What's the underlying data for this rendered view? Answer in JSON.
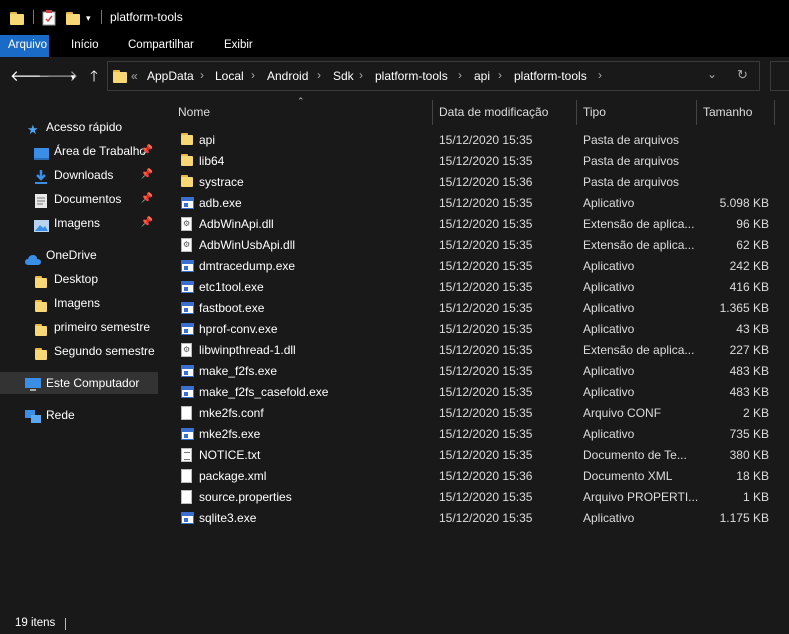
{
  "window": {
    "title": "platform-tools"
  },
  "ribbon": {
    "tabs": [
      "Arquivo",
      "Início",
      "Compartilhar",
      "Exibir"
    ]
  },
  "nav": {
    "overflow": "«",
    "breadcrumbs": [
      "AppData",
      "Local",
      "Android",
      "Sdk",
      "platform-tools",
      "api",
      "platform-tools"
    ]
  },
  "sidebar": {
    "quick_access": "Acesso rápido",
    "quick_items": [
      "Área de Trabalho",
      "Downloads",
      "Documentos",
      "Imagens"
    ],
    "onedrive": "OneDrive",
    "onedrive_items": [
      "Desktop",
      "Imagens",
      "primeiro semestre",
      "Segundo semestre"
    ],
    "this_pc": "Este Computador",
    "network": "Rede"
  },
  "columns": {
    "name": "Nome",
    "date": "Data de modificação",
    "type": "Tipo",
    "size": "Tamanho"
  },
  "files": [
    {
      "icon": "folder-icon",
      "name": "api",
      "date": "15/12/2020 15:35",
      "type": "Pasta de arquivos",
      "size": ""
    },
    {
      "icon": "folder-icon",
      "name": "lib64",
      "date": "15/12/2020 15:35",
      "type": "Pasta de arquivos",
      "size": ""
    },
    {
      "icon": "folder-icon",
      "name": "systrace",
      "date": "15/12/2020 15:36",
      "type": "Pasta de arquivos",
      "size": ""
    },
    {
      "icon": "exe-icon",
      "name": "adb.exe",
      "date": "15/12/2020 15:35",
      "type": "Aplicativo",
      "size": "5.098 KB"
    },
    {
      "icon": "dll-icon",
      "name": "AdbWinApi.dll",
      "date": "15/12/2020 15:35",
      "type": "Extensão de aplica...",
      "size": "96 KB"
    },
    {
      "icon": "dll-icon",
      "name": "AdbWinUsbApi.dll",
      "date": "15/12/2020 15:35",
      "type": "Extensão de aplica...",
      "size": "62 KB"
    },
    {
      "icon": "exe-icon",
      "name": "dmtracedump.exe",
      "date": "15/12/2020 15:35",
      "type": "Aplicativo",
      "size": "242 KB"
    },
    {
      "icon": "exe-icon",
      "name": "etc1tool.exe",
      "date": "15/12/2020 15:35",
      "type": "Aplicativo",
      "size": "416 KB"
    },
    {
      "icon": "exe-icon",
      "name": "fastboot.exe",
      "date": "15/12/2020 15:35",
      "type": "Aplicativo",
      "size": "1.365 KB"
    },
    {
      "icon": "exe-icon",
      "name": "hprof-conv.exe",
      "date": "15/12/2020 15:35",
      "type": "Aplicativo",
      "size": "43 KB"
    },
    {
      "icon": "dll-icon",
      "name": "libwinpthread-1.dll",
      "date": "15/12/2020 15:35",
      "type": "Extensão de aplica...",
      "size": "227 KB"
    },
    {
      "icon": "exe-icon",
      "name": "make_f2fs.exe",
      "date": "15/12/2020 15:35",
      "type": "Aplicativo",
      "size": "483 KB"
    },
    {
      "icon": "exe-icon",
      "name": "make_f2fs_casefold.exe",
      "date": "15/12/2020 15:35",
      "type": "Aplicativo",
      "size": "483 KB"
    },
    {
      "icon": "file-icon",
      "name": "mke2fs.conf",
      "date": "15/12/2020 15:35",
      "type": "Arquivo CONF",
      "size": "2 KB"
    },
    {
      "icon": "exe-icon",
      "name": "mke2fs.exe",
      "date": "15/12/2020 15:35",
      "type": "Aplicativo",
      "size": "735 KB"
    },
    {
      "icon": "text-file-icon",
      "name": "NOTICE.txt",
      "date": "15/12/2020 15:35",
      "type": "Documento de Te...",
      "size": "380 KB"
    },
    {
      "icon": "file-icon",
      "name": "package.xml",
      "date": "15/12/2020 15:36",
      "type": "Documento XML",
      "size": "18 KB"
    },
    {
      "icon": "file-icon",
      "name": "source.properties",
      "date": "15/12/2020 15:35",
      "type": "Arquivo PROPERTI...",
      "size": "1 KB"
    },
    {
      "icon": "exe-icon",
      "name": "sqlite3.exe",
      "date": "15/12/2020 15:35",
      "type": "Aplicativo",
      "size": "1.175 KB"
    }
  ],
  "status": {
    "count": "19 itens"
  },
  "colors": {
    "accent": "#1a6ac8",
    "background": "#191919",
    "folder": "#f8d775"
  }
}
